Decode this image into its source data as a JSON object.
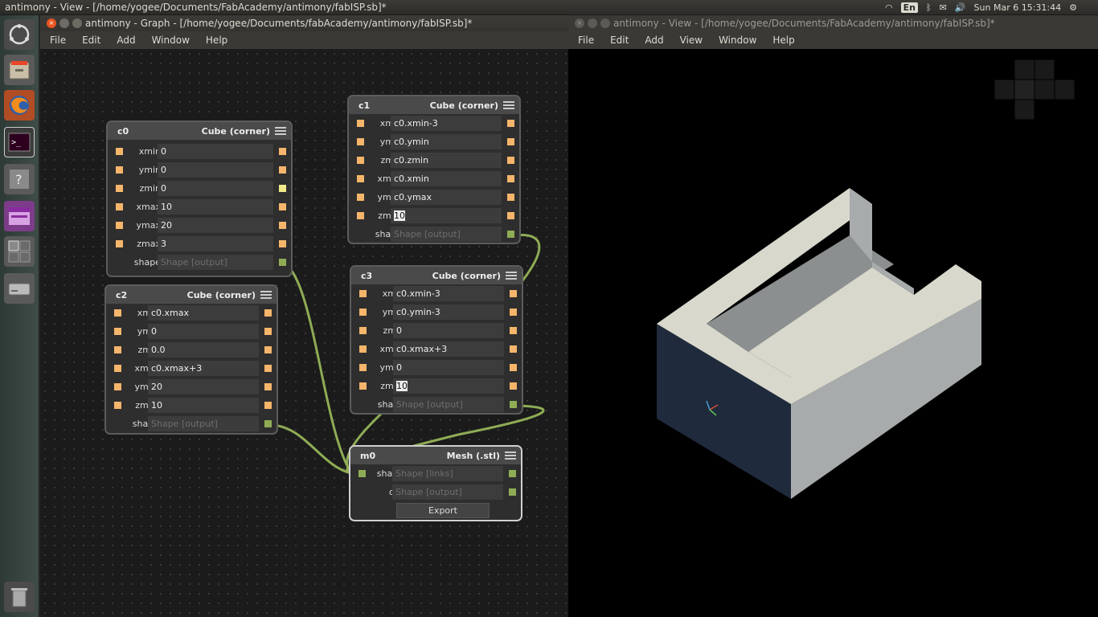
{
  "topbar": {
    "title": "antimony - View - [/home/yogee/Documents/FabAcademy/antimony/fabISP.sb]*",
    "keyboard": "En",
    "clock": "Sun Mar  6 15:31:44"
  },
  "graph_window": {
    "title": "antimony - Graph - [/home/yogee/Documents/fabAcademy/antimony/fabISP.sb]*",
    "menu": [
      "File",
      "Edit",
      "Add",
      "Window",
      "Help"
    ]
  },
  "view_window": {
    "title": "antimony - View - [/home/yogee/Documents/FabAcademy/antimony/fabISP.sb]*",
    "menu": [
      "File",
      "Edit",
      "Add",
      "View",
      "Window",
      "Help"
    ]
  },
  "nodes": {
    "c0": {
      "name": "c0",
      "type": "Cube (corner)",
      "rows": [
        {
          "label": "xmin",
          "value": "0"
        },
        {
          "label": "ymin",
          "value": "0"
        },
        {
          "label": "zmin",
          "value": "0"
        },
        {
          "label": "xmax",
          "value": "10"
        },
        {
          "label": "ymax",
          "value": "20"
        },
        {
          "label": "zmax",
          "value": "3"
        },
        {
          "label": "shape",
          "value": "Shape [output]"
        }
      ]
    },
    "c1": {
      "name": "c1",
      "type": "Cube (corner)",
      "rows": [
        {
          "label": "xmin",
          "value": "c0.xmin-3"
        },
        {
          "label": "ymin",
          "value": "c0.ymin"
        },
        {
          "label": "zmin",
          "value": "c0.zmin"
        },
        {
          "label": "xmax",
          "value": "c0.xmin"
        },
        {
          "label": "ymax",
          "value": "c0.ymax"
        },
        {
          "label": "zmax",
          "value": "10"
        },
        {
          "label": "shape",
          "value": "Shape [output]"
        }
      ]
    },
    "c2": {
      "name": "c2",
      "type": "Cube (corner)",
      "rows": [
        {
          "label": "xmin",
          "value": "c0.xmax"
        },
        {
          "label": "ymin",
          "value": "0"
        },
        {
          "label": "zmin",
          "value": "0.0"
        },
        {
          "label": "xmax",
          "value": "c0.xmax+3"
        },
        {
          "label": "ymax",
          "value": "20"
        },
        {
          "label": "zmax",
          "value": "10"
        },
        {
          "label": "shape",
          "value": "Shape [output]"
        }
      ]
    },
    "c3": {
      "name": "c3",
      "type": "Cube (corner)",
      "rows": [
        {
          "label": "xmin",
          "value": "c0.xmin-3"
        },
        {
          "label": "ymin",
          "value": "c0.ymin-3"
        },
        {
          "label": "zmin",
          "value": "0"
        },
        {
          "label": "xmax",
          "value": "c0.xmax+3"
        },
        {
          "label": "ymax",
          "value": "0"
        },
        {
          "label": "zmax",
          "value": "10"
        },
        {
          "label": "shape",
          "value": "Shape [output]"
        }
      ]
    },
    "m0": {
      "name": "m0",
      "type": "Mesh (.stl)",
      "rows": [
        {
          "label": "shape",
          "value": "Shape [links]"
        },
        {
          "label": "out",
          "value": "Shape [output]"
        }
      ],
      "export_label": "Export"
    }
  },
  "colors": {
    "wire": "#8fac55",
    "pin_float": "#f5b56b",
    "pin_shape": "#8fac55",
    "model_top": "#d9d8cc",
    "model_right": "#a8abab",
    "model_front": "#1f2b3c"
  }
}
